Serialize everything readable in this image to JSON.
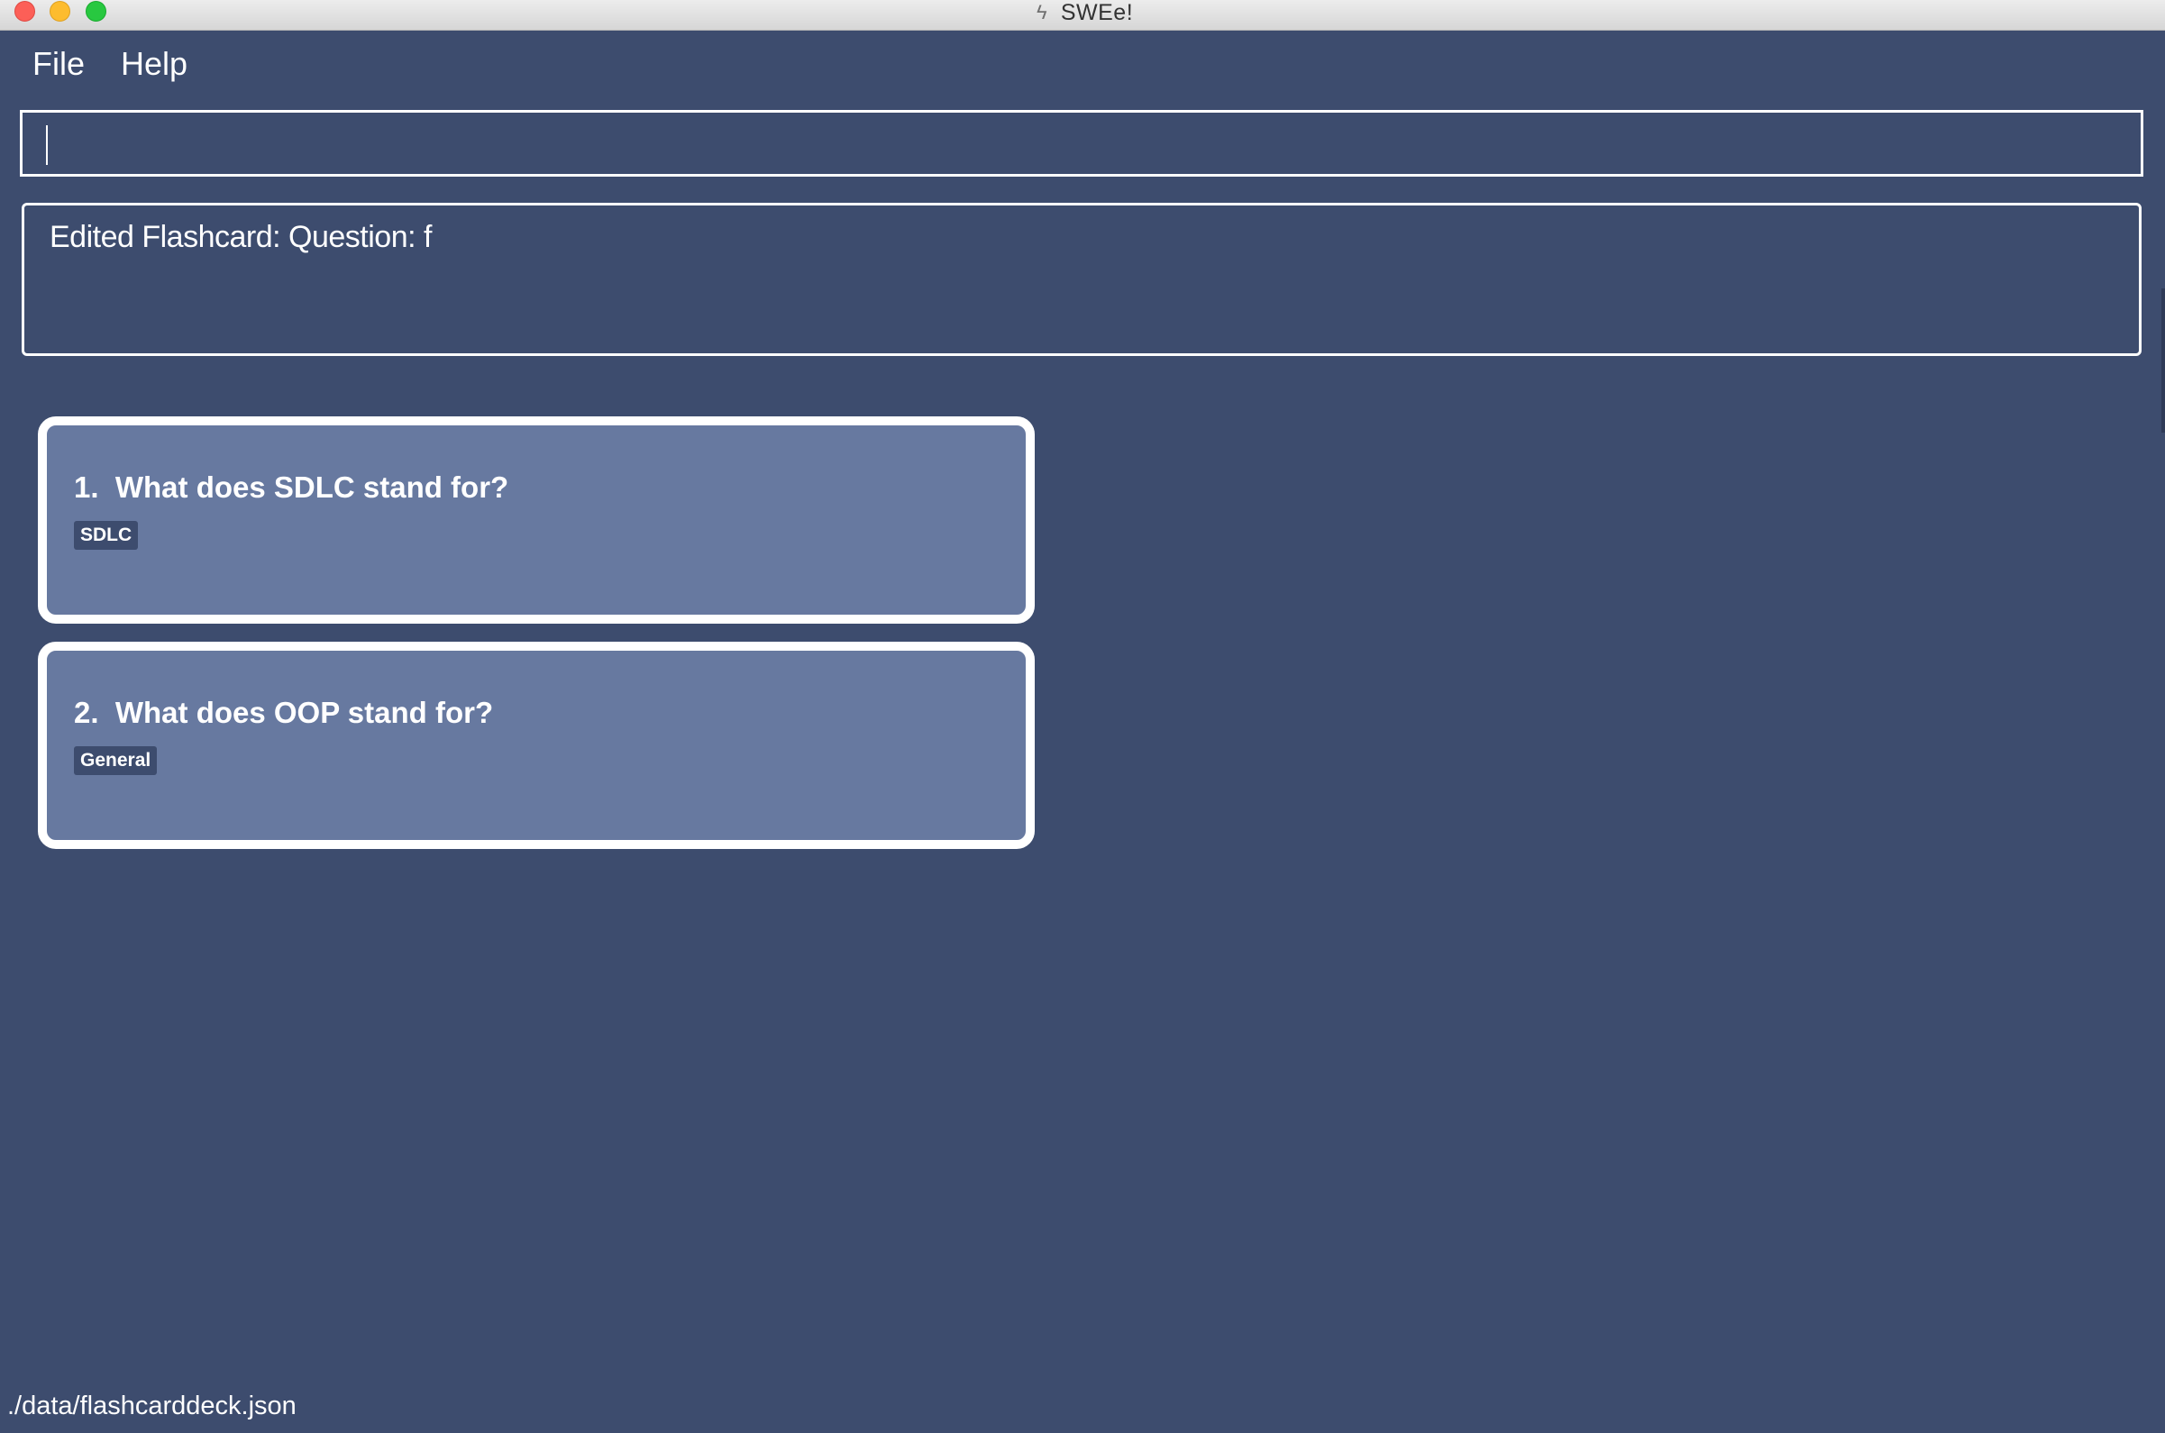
{
  "window": {
    "title": "SWEe!",
    "icon": "lightning-icon"
  },
  "menu": {
    "items": [
      "File",
      "Help"
    ]
  },
  "command": {
    "value": "",
    "placeholder": ""
  },
  "result": {
    "text": "Edited Flashcard:  Question: f"
  },
  "flashcards": [
    {
      "index": "1.",
      "question": "What does SDLC stand for?",
      "tag": "SDLC"
    },
    {
      "index": "2.",
      "question": "What does OOP stand for?",
      "tag": "General"
    }
  ],
  "status": {
    "path": "./data/flashcarddeck.json"
  },
  "colors": {
    "background": "#3d4c6e",
    "card": "#6779a0",
    "border": "#ffffff"
  }
}
